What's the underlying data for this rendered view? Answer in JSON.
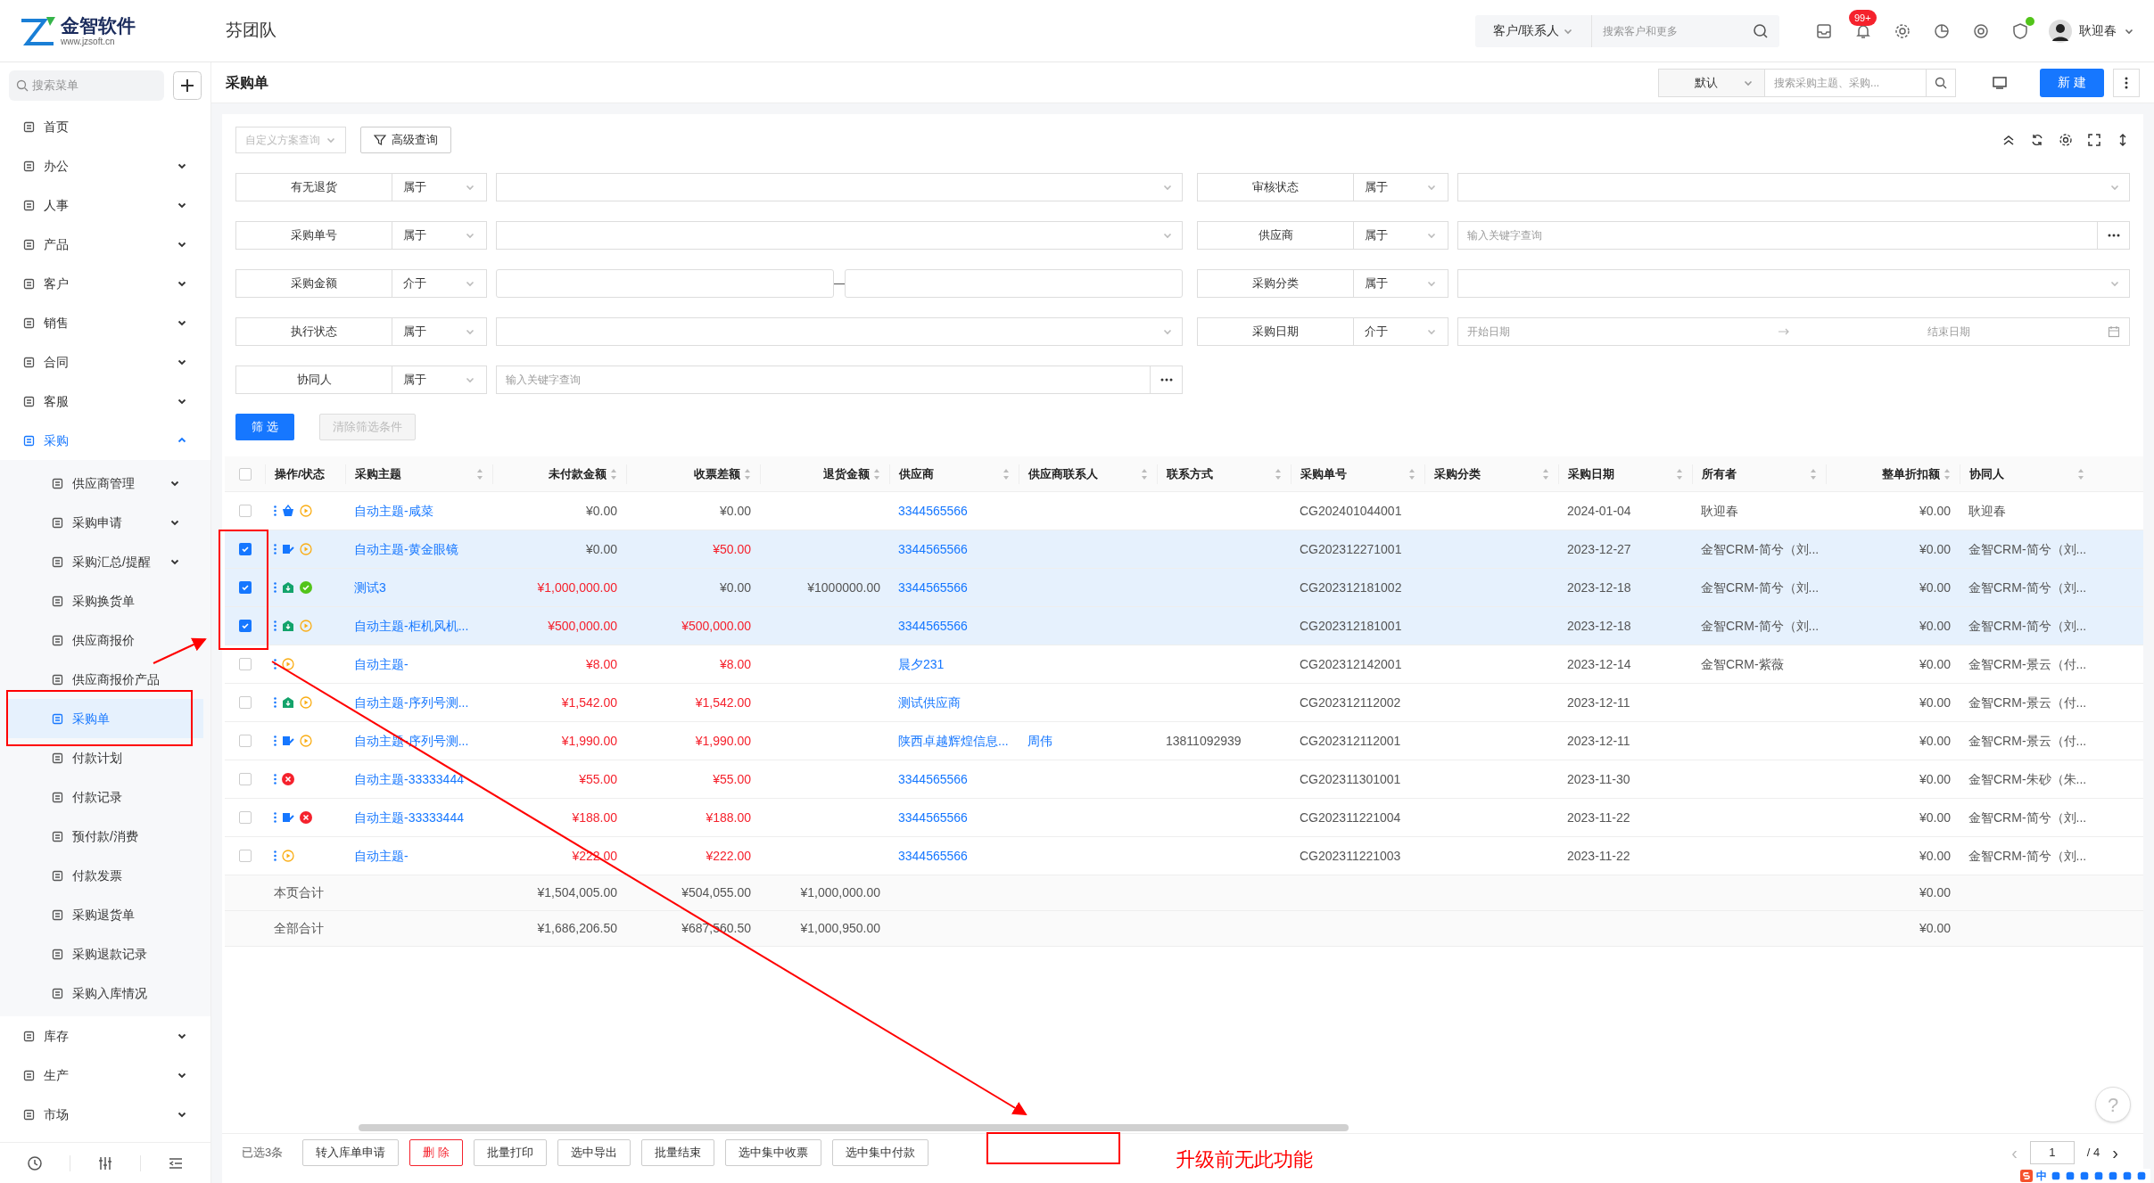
{
  "header": {
    "logo_text": "金智软件",
    "logo_url": "www.jzsoft.cn",
    "team": "芬团队",
    "search_scope": "客户/联系人",
    "search_placeholder": "搜索客户和更多",
    "notification_badge": "99+",
    "user": "耿迎春"
  },
  "sidebar": {
    "search_placeholder": "搜索菜单",
    "items": [
      {
        "label": "首页",
        "selected": false
      },
      {
        "label": "办公",
        "selected": false,
        "expanded": false
      },
      {
        "label": "人事",
        "selected": false,
        "expanded": false
      },
      {
        "label": "产品",
        "selected": false,
        "expanded": false
      },
      {
        "label": "客户",
        "selected": false,
        "expanded": false
      },
      {
        "label": "销售",
        "selected": false,
        "expanded": false
      },
      {
        "label": "合同",
        "selected": false,
        "expanded": false
      },
      {
        "label": "客服",
        "selected": false,
        "expanded": false
      },
      {
        "label": "采购",
        "selected": true,
        "expanded": true,
        "children": [
          {
            "label": "供应商管理",
            "selected": false,
            "expanded": false
          },
          {
            "label": "采购申请",
            "selected": false,
            "expanded": false
          },
          {
            "label": "采购汇总/提醒",
            "selected": false,
            "expanded": false
          },
          {
            "label": "采购换货单",
            "selected": false
          },
          {
            "label": "供应商报价",
            "selected": false
          },
          {
            "label": "供应商报价产品",
            "selected": false
          },
          {
            "label": "采购单",
            "selected": true
          },
          {
            "label": "付款计划",
            "selected": false
          },
          {
            "label": "付款记录",
            "selected": false
          },
          {
            "label": "预付款/消费",
            "selected": false
          },
          {
            "label": "付款发票",
            "selected": false
          },
          {
            "label": "采购退货单",
            "selected": false
          },
          {
            "label": "采购退款记录",
            "selected": false
          },
          {
            "label": "采购入库情况",
            "selected": false
          }
        ]
      },
      {
        "label": "库存",
        "selected": false,
        "expanded": false
      },
      {
        "label": "生产",
        "selected": false,
        "expanded": false
      },
      {
        "label": "市场",
        "selected": false,
        "expanded": false
      }
    ]
  },
  "page": {
    "title": "采购单",
    "view": "默认",
    "search_placeholder": "搜索采购主题、采购...",
    "new_button": "新 建"
  },
  "filter_bar": {
    "scheme_placeholder": "自定义方案查询",
    "advanced": "高级查询",
    "apply": "筛 选",
    "clear": "清除筛选条件"
  },
  "filters": [
    {
      "left": {
        "label": "有无退货",
        "operator": "属于",
        "kind": "select"
      },
      "right": {
        "label": "审核状态",
        "operator": "属于",
        "kind": "select"
      }
    },
    {
      "left": {
        "label": "采购单号",
        "operator": "属于",
        "kind": "select"
      },
      "right": {
        "label": "供应商",
        "operator": "属于",
        "kind": "picker",
        "placeholder": "输入关键字查询"
      }
    },
    {
      "left": {
        "label": "采购金额",
        "operator": "介于",
        "kind": "range"
      },
      "right": {
        "label": "采购分类",
        "operator": "属于",
        "kind": "select"
      }
    },
    {
      "left": {
        "label": "执行状态",
        "operator": "属于",
        "kind": "select"
      },
      "right": {
        "label": "采购日期",
        "operator": "介于",
        "kind": "date_range",
        "placeholder": "开始日期",
        "placeholder_end": "结束日期"
      }
    },
    {
      "left": {
        "label": "协同人",
        "operator": "属于",
        "kind": "picker",
        "placeholder": "输入关键字查询"
      }
    }
  ],
  "table": {
    "all_selected": false,
    "columns": [
      "操作/状态",
      "采购主题",
      "未付款金额",
      "收票差额",
      "退货金额",
      "供应商",
      "供应商联系人",
      "联系方式",
      "采购单号",
      "采购分类",
      "采购日期",
      "所有者",
      "整单折扣额",
      "协同人"
    ],
    "rows": [
      {
        "selected": false,
        "icons": [
          {
            "kind": "basket"
          },
          {
            "kind": "play"
          }
        ],
        "subject": "自动主题-咸菜",
        "unpaid": "¥0.00",
        "unpaid_red": false,
        "invoice_diff": "¥0.00",
        "invoice_red": false,
        "supplier": "3344565566",
        "order_no": "CG202401044001",
        "date": "2024-01-04",
        "owner": "耿迎春",
        "discount": "¥0.00",
        "collaborator": "耿迎春"
      },
      {
        "selected": true,
        "icons": [
          {
            "kind": "edit"
          },
          {
            "kind": "play"
          }
        ],
        "subject": "自动主题-黄金眼镜",
        "unpaid": "¥0.00",
        "unpaid_red": false,
        "invoice_diff": "¥50.00",
        "invoice_red": true,
        "supplier": "3344565566",
        "order_no": "CG202312271001",
        "date": "2023-12-27",
        "owner": "金智CRM-简兮（刘...",
        "discount": "¥0.00",
        "collaborator": "金智CRM-简兮（刘..."
      },
      {
        "selected": true,
        "icons": [
          {
            "kind": "inbound"
          },
          {
            "kind": "check"
          }
        ],
        "subject": "测试3",
        "unpaid": "¥1,000,000.00",
        "unpaid_red": true,
        "invoice_diff": "¥0.00",
        "invoice_red": false,
        "returned": "¥1000000.00",
        "supplier": "3344565566",
        "order_no": "CG202312181002",
        "date": "2023-12-18",
        "owner": "金智CRM-简兮（刘...",
        "discount": "¥0.00",
        "collaborator": "金智CRM-简兮（刘..."
      },
      {
        "selected": true,
        "icons": [
          {
            "kind": "inbound"
          },
          {
            "kind": "play"
          }
        ],
        "subject": "自动主题-柜机风机...",
        "unpaid": "¥500,000.00",
        "unpaid_red": true,
        "invoice_diff": "¥500,000.00",
        "invoice_red": true,
        "supplier": "3344565566",
        "order_no": "CG202312181001",
        "date": "2023-12-18",
        "owner": "金智CRM-简兮（刘...",
        "discount": "¥0.00",
        "collaborator": "金智CRM-简兮（刘..."
      },
      {
        "selected": false,
        "icons": [
          {
            "kind": "play"
          }
        ],
        "subject": "自动主题-",
        "unpaid": "¥8.00",
        "unpaid_red": true,
        "invoice_diff": "¥8.00",
        "invoice_red": true,
        "supplier": "晨夕231",
        "order_no": "CG202312142001",
        "date": "2023-12-14",
        "owner": "金智CRM-紫薇",
        "discount": "¥0.00",
        "collaborator": "金智CRM-景云（付..."
      },
      {
        "selected": false,
        "icons": [
          {
            "kind": "inbound"
          },
          {
            "kind": "play"
          }
        ],
        "subject": "自动主题-序列号测...",
        "unpaid": "¥1,542.00",
        "unpaid_red": true,
        "invoice_diff": "¥1,542.00",
        "invoice_red": true,
        "supplier": "测试供应商",
        "order_no": "CG202312112002",
        "date": "2023-12-11",
        "discount": "¥0.00",
        "collaborator": "金智CRM-景云（付..."
      },
      {
        "selected": false,
        "icons": [
          {
            "kind": "edit"
          },
          {
            "kind": "play"
          }
        ],
        "subject": "自动主题-序列号测...",
        "unpaid": "¥1,990.00",
        "unpaid_red": true,
        "invoice_diff": "¥1,990.00",
        "invoice_red": true,
        "supplier": "陕西卓越辉煌信息...",
        "supplier_contact": "周伟",
        "contact": "13811092939",
        "order_no": "CG202312112001",
        "date": "2023-12-11",
        "discount": "¥0.00",
        "collaborator": "金智CRM-景云（付..."
      },
      {
        "selected": false,
        "icons": [
          {
            "kind": "cross"
          }
        ],
        "subject": "自动主题-33333444",
        "unpaid": "¥55.00",
        "unpaid_red": true,
        "invoice_diff": "¥55.00",
        "invoice_red": true,
        "supplier": "3344565566",
        "order_no": "CG202311301001",
        "date": "2023-11-30",
        "discount": "¥0.00",
        "collaborator": "金智CRM-朱砂（朱..."
      },
      {
        "selected": false,
        "icons": [
          {
            "kind": "edit"
          },
          {
            "kind": "cross"
          }
        ],
        "subject": "自动主题-33333444",
        "unpaid": "¥188.00",
        "unpaid_red": true,
        "invoice_diff": "¥188.00",
        "invoice_red": true,
        "supplier": "3344565566",
        "order_no": "CG202311221004",
        "date": "2023-11-22",
        "discount": "¥0.00",
        "collaborator": "金智CRM-简兮（刘..."
      },
      {
        "selected": false,
        "icons": [
          {
            "kind": "play"
          }
        ],
        "subject": "自动主题-",
        "unpaid": "¥222.00",
        "unpaid_red": true,
        "invoice_diff": "¥222.00",
        "invoice_red": true,
        "supplier": "3344565566",
        "order_no": "CG202311221003",
        "date": "2023-11-22",
        "discount": "¥0.00",
        "collaborator": "金智CRM-简兮（刘..."
      }
    ],
    "totals": [
      {
        "label": "本页合计",
        "unpaid": "¥1,504,005.00",
        "invoice_diff": "¥504,055.00",
        "returned": "¥1,000,000.00",
        "discount": "¥0.00"
      },
      {
        "label": "全部合计",
        "unpaid": "¥1,686,206.50",
        "invoice_diff": "¥687,560.50",
        "returned": "¥1,000,950.00",
        "discount": "¥0.00"
      }
    ]
  },
  "bulk_bar": {
    "selected_count": "已选3条",
    "actions": [
      {
        "label": "转入库单申请",
        "kind": "normal"
      },
      {
        "label": "删 除",
        "kind": "danger"
      },
      {
        "label": "批量打印",
        "kind": "normal"
      },
      {
        "label": "选中导出",
        "kind": "normal"
      },
      {
        "label": "批量结束",
        "kind": "normal"
      },
      {
        "label": "选中集中收票",
        "kind": "normal"
      },
      {
        "label": "选中集中付款",
        "kind": "normal"
      }
    ]
  },
  "pagination": {
    "prev": "‹",
    "page": "1",
    "total": "/ 4",
    "next": "›"
  },
  "help": "?",
  "ime": {
    "mode": "中"
  },
  "annotation": {
    "note": "升级前无此功能"
  }
}
